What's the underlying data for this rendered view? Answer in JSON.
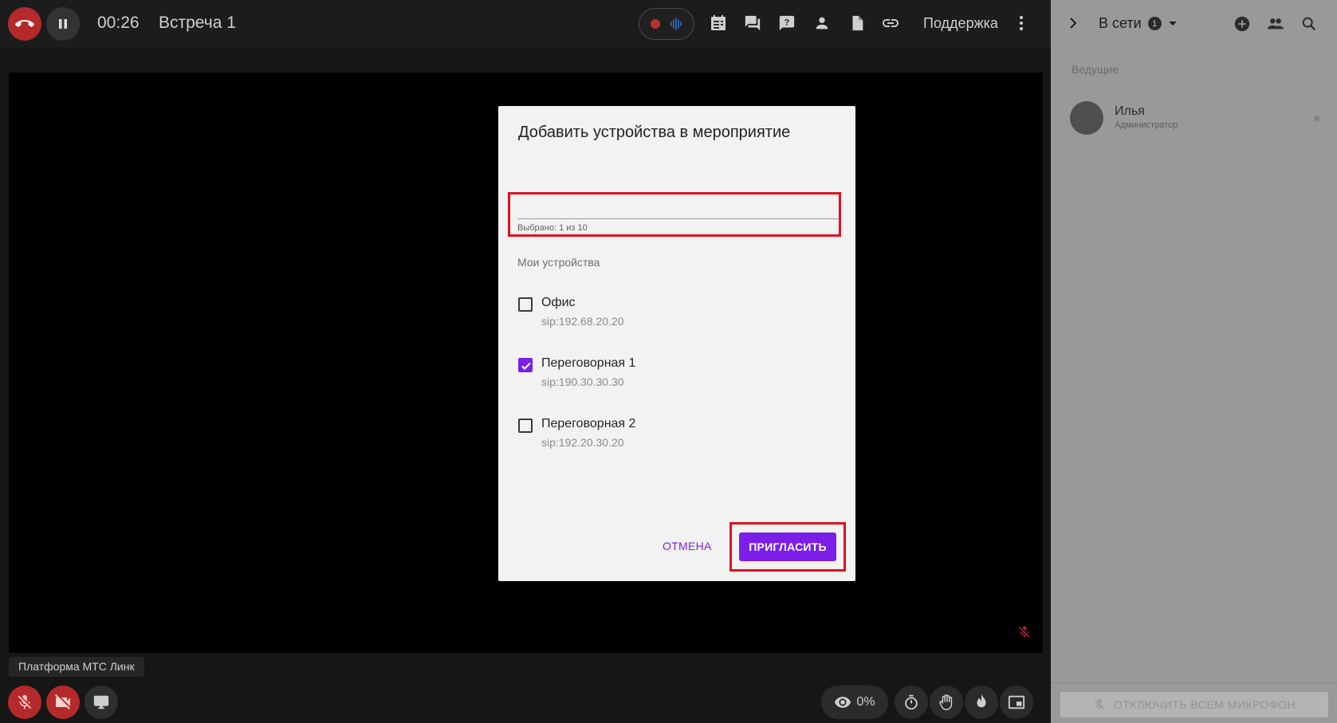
{
  "topbar": {
    "timer": "00:26",
    "meeting_title": "Встреча 1",
    "support_label": "Поддержка"
  },
  "stage": {
    "platform_label": "Платформа МТС Линк",
    "views_percent": "0%"
  },
  "sidebar": {
    "online_label": "В сети",
    "online_count": "1",
    "section_hosts": "Ведущие",
    "participants": [
      {
        "name": "Илья",
        "role": "Администратор",
        "self_marker": "я"
      }
    ],
    "mute_all_label": "ОТКЛЮЧИТЬ ВСЕМ МИКРОФОН"
  },
  "dialog": {
    "title": "Добавить устройства в мероприятие",
    "input_value": "",
    "helper_text": "Выбрано: 1 из 10",
    "section_label": "Мои устройства",
    "devices": [
      {
        "name": "Офис",
        "sip": "sip:192.68.20.20",
        "checked": false
      },
      {
        "name": "Переговорная 1",
        "sip": "sip:190.30.30.30",
        "checked": true
      },
      {
        "name": "Переговорная 2",
        "sip": "sip:192.20.30.20",
        "checked": false
      }
    ],
    "cancel_label": "ОТМЕНА",
    "invite_label": "ПРИГЛАСИТЬ"
  },
  "colors": {
    "accent": "#7b1fe8",
    "highlight": "#e0101e",
    "danger": "#b42a2a",
    "sidebar_bg": "#999999"
  }
}
